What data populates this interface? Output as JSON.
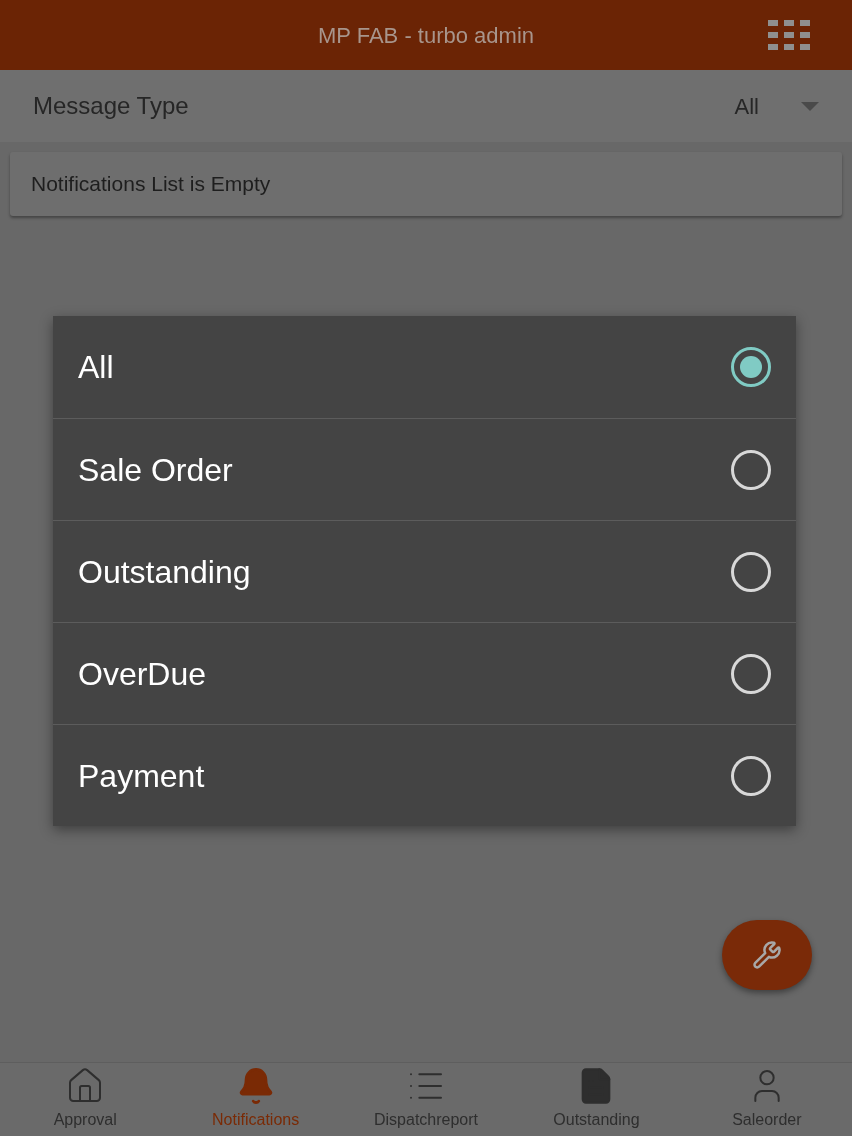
{
  "app_bar": {
    "title": "MP FAB - turbo admin"
  },
  "filter": {
    "label": "Message Type",
    "value": "All"
  },
  "message": "Notifications List is Empty",
  "dialog": {
    "options": [
      {
        "label": "All",
        "selected": true
      },
      {
        "label": "Sale Order",
        "selected": false
      },
      {
        "label": "Outstanding",
        "selected": false
      },
      {
        "label": "OverDue",
        "selected": false
      },
      {
        "label": "Payment",
        "selected": false
      }
    ]
  },
  "bottom_nav": [
    {
      "label": "Approval",
      "kind": "home",
      "selected": false
    },
    {
      "label": "Notifications",
      "kind": "bell",
      "selected": true
    },
    {
      "label": "Dispatchreport",
      "kind": "list",
      "selected": false
    },
    {
      "label": "Outstanding",
      "kind": "document",
      "selected": false
    },
    {
      "label": "Saleorder",
      "kind": "user",
      "selected": false
    }
  ]
}
